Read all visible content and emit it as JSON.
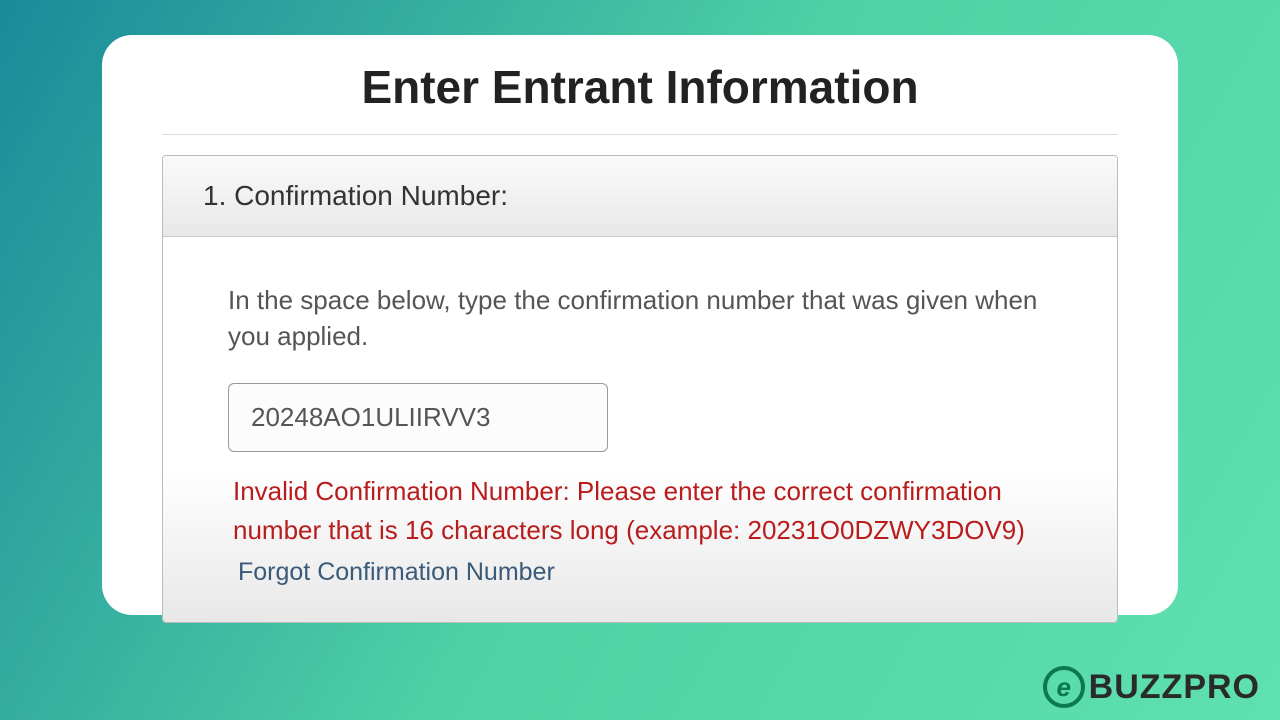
{
  "page": {
    "title": "Enter Entrant Information"
  },
  "section": {
    "header": "1. Confirmation Number:",
    "instruction": "In the space below, type the confirmation number that was given when you applied.",
    "input_value": "20248AO1ULIIRVV3",
    "error_message": "Invalid Confirmation Number: Please enter the correct confirmation number that is 16 characters long (example: 20231O0DZWY3DOV9)",
    "forgot_link": "Forgot Confirmation Number"
  },
  "watermark": {
    "icon_letter": "e",
    "text": "BUZZPRO"
  }
}
